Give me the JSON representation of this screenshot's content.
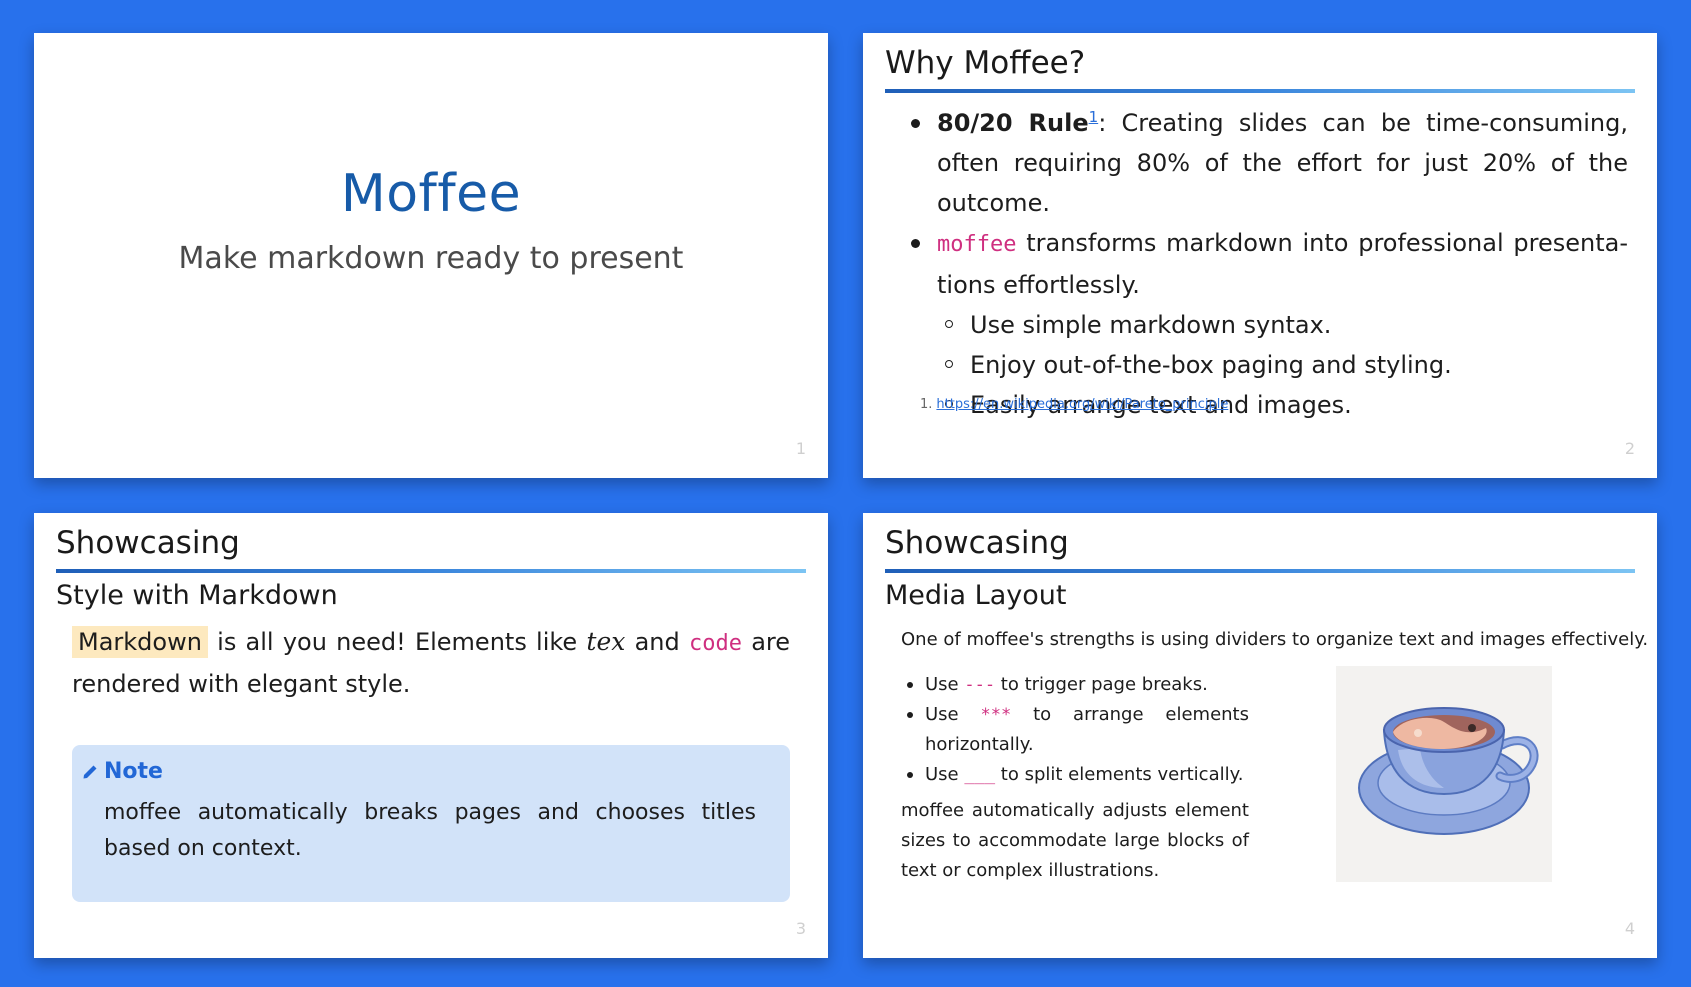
{
  "slides": [
    {
      "title": "Moffee",
      "subtitle": "Make markdown ready to present",
      "number": "1"
    },
    {
      "title": "Why Moffee?",
      "bullet1_bold": "80/20 Rule",
      "bullet1_ref": "1",
      "bullet1_text": ": Creating slides can be time-consuming, often requiring 80% of the effort for just 20% of the outcome.",
      "bullet2_code": "moffee",
      "bullet2_text": " transforms markdown into professional presenta­tions effortlessly.",
      "sub_items": [
        "Use simple markdown syntax.",
        "Enjoy out-of-the-box paging and styling.",
        "Easily arrange text and images."
      ],
      "footnote_num": "1.",
      "footnote_link": "https://en.wikipedia.org/wiki/Pareto_principle",
      "number": "2"
    },
    {
      "title": "Showcasing",
      "subtitle": "Style with Markdown",
      "highlight": "Markdown",
      "text_a": " is all you need! Elements like ",
      "tex": "tex",
      "text_b": " and ",
      "code": "code",
      "text_c": " are rendered with elegant style.",
      "note_label": "Note",
      "note_text": "moffee automatically breaks pages and chooses titles based on context.",
      "number": "3"
    },
    {
      "title": "Showcasing",
      "subtitle": "Media Layout",
      "intro": "One of moffee's strengths is using dividers to organize text and images effectively.",
      "items": [
        {
          "pre": "Use ",
          "code": "---",
          "post": " to trigger page breaks."
        },
        {
          "pre": "Use ",
          "code": "***",
          "post": " to arrange elements horizontally."
        },
        {
          "pre": "Use ",
          "code": "___",
          "post": " to split elements vertically."
        }
      ],
      "paragraph": "moffee automatically adjusts element sizes to accommodate large blocks of text or complex illustrations.",
      "image_icon": "coffee-cup-icon",
      "number": "4"
    }
  ],
  "colors": {
    "background": "#2871ec",
    "title_blue": "#175ba8",
    "code_pink": "#cf2f80",
    "note_bg": "#d2e3f9",
    "note_accent": "#2267d6",
    "highlight": "#fde9bf"
  }
}
